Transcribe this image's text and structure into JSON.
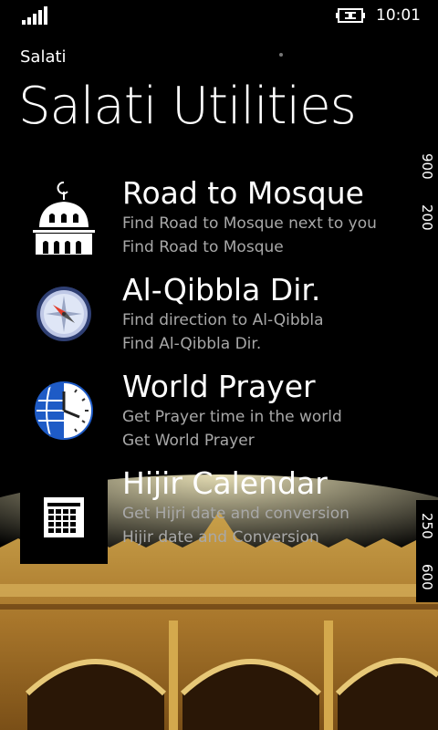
{
  "status": {
    "time": "10:01",
    "icons": [
      "signal-bars-icon",
      "battery-charging-icon"
    ]
  },
  "header": {
    "app_name": "Salati",
    "title": "Salati Utilities"
  },
  "side_tags": {
    "top": [
      "900",
      "200"
    ],
    "bottom": [
      "250",
      "600"
    ]
  },
  "items": [
    {
      "title": "Road to Mosque",
      "subtitle": "Find Road to Mosque next to you",
      "detail": "Find Road to Mosque",
      "icon": "mosque-icon"
    },
    {
      "title": "Al-Qibbla Dir.",
      "subtitle": "Find direction to Al-Qibbla",
      "detail": "Find Al-Qibbla Dir.",
      "icon": "compass-icon"
    },
    {
      "title": "World Prayer",
      "subtitle": "Get Prayer time in the world",
      "detail": "Get World Prayer",
      "icon": "globe-clock-icon"
    },
    {
      "title": "Hijir Calendar",
      "subtitle": "Get Hijri date and conversion",
      "detail": "Hijir date and Conversion",
      "icon": "calendar-icon"
    }
  ]
}
